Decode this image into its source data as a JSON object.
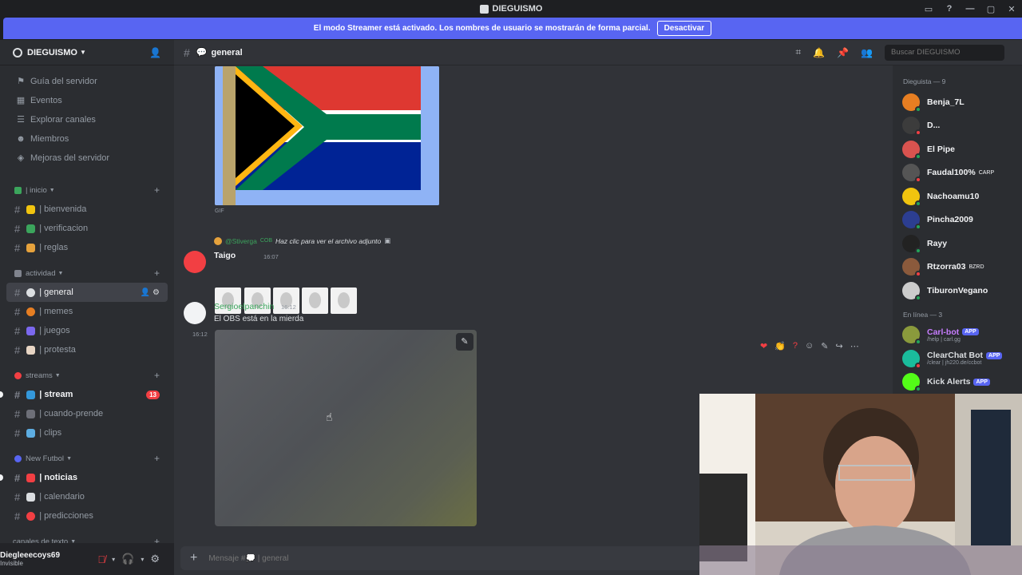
{
  "window": {
    "title": "DIEGUISMO"
  },
  "banner": {
    "text": "El modo Streamer está activado. Los nombres de usuario se mostrarán de forma parcial.",
    "button": "Desactivar"
  },
  "server": {
    "name": "DIEGUISMO"
  },
  "nav": [
    {
      "label": "Guía del servidor",
      "icon": "signpost-icon"
    },
    {
      "label": "Eventos",
      "icon": "calendar-icon"
    },
    {
      "label": "Explorar canales",
      "icon": "browse-icon"
    },
    {
      "label": "Miembros",
      "icon": "members-icon"
    },
    {
      "label": "Mejoras del servidor",
      "icon": "boost-icon"
    }
  ],
  "categories": [
    {
      "label": "| inicio",
      "channels": [
        "| bienvenida",
        "| verificacion",
        "| reglas"
      ]
    },
    {
      "label": "actividad",
      "channels": [
        "| general",
        "| memes",
        "| juegos",
        "| protesta"
      ]
    },
    {
      "label": "streams",
      "channels": [
        "| stream",
        "| cuando-prende",
        "| clips"
      ]
    },
    {
      "label": "New Futbol",
      "channels": [
        "| noticias",
        "| calendario",
        "| predicciones"
      ]
    },
    {
      "label": "canales de texto",
      "channels": []
    }
  ],
  "badges": {
    "stream": "13"
  },
  "user": {
    "name": "Diegleeecoys69",
    "status": "Invisible"
  },
  "channel": {
    "name": "general"
  },
  "search": {
    "placeholder": "Buscar DIEGUISMO"
  },
  "messages": {
    "gif_label": "GIF",
    "reply": {
      "name": "@Stiverga",
      "tag": "COB",
      "text": "Haz clic para ver el archivo adjunto"
    },
    "taigo": {
      "author": "Taigo",
      "time": "16:07"
    },
    "sergio": {
      "author": "Sergioelpanchin",
      "time": "16:12",
      "text": "El OBS está en la mierda",
      "side_time": "16:12"
    }
  },
  "composer": {
    "placeholder": "Mensaje #💭 | general"
  },
  "members": {
    "group1": "Dieguista — 9",
    "list1": [
      {
        "name": "Benja_7L",
        "tag": "",
        "color": "#e67e22"
      },
      {
        "name": "D...",
        "tag": "",
        "color": "#3c3c3c"
      },
      {
        "name": "El Pipe",
        "tag": "",
        "color": "#d9534f"
      },
      {
        "name": "Faudal100%",
        "tag": "CARP",
        "color": "#555"
      },
      {
        "name": "Nachoamu10",
        "tag": "",
        "color": "#f1c40f"
      },
      {
        "name": "Pincha2009",
        "tag": "",
        "color": "#2c3e91"
      },
      {
        "name": "Rayy",
        "tag": "",
        "color": "#222"
      },
      {
        "name": "Rtzorra03",
        "tag": "BZRD",
        "color": "#8b5a3c"
      },
      {
        "name": "TiburonVegano",
        "tag": "",
        "color": "#ccc"
      }
    ],
    "group2": "En línea — 3",
    "list2": [
      {
        "name": "Carl-bot",
        "sub": "/help | carl.gg",
        "app": "APP",
        "color": "#8a9a3c"
      },
      {
        "name": "ClearChat Bot",
        "sub": "/clear | jh220.de/ccbot",
        "app": "APP",
        "color": "#1abc9c"
      },
      {
        "name": "Kick Alerts",
        "sub": "",
        "app": "APP",
        "color": "#53fc18"
      }
    ]
  }
}
